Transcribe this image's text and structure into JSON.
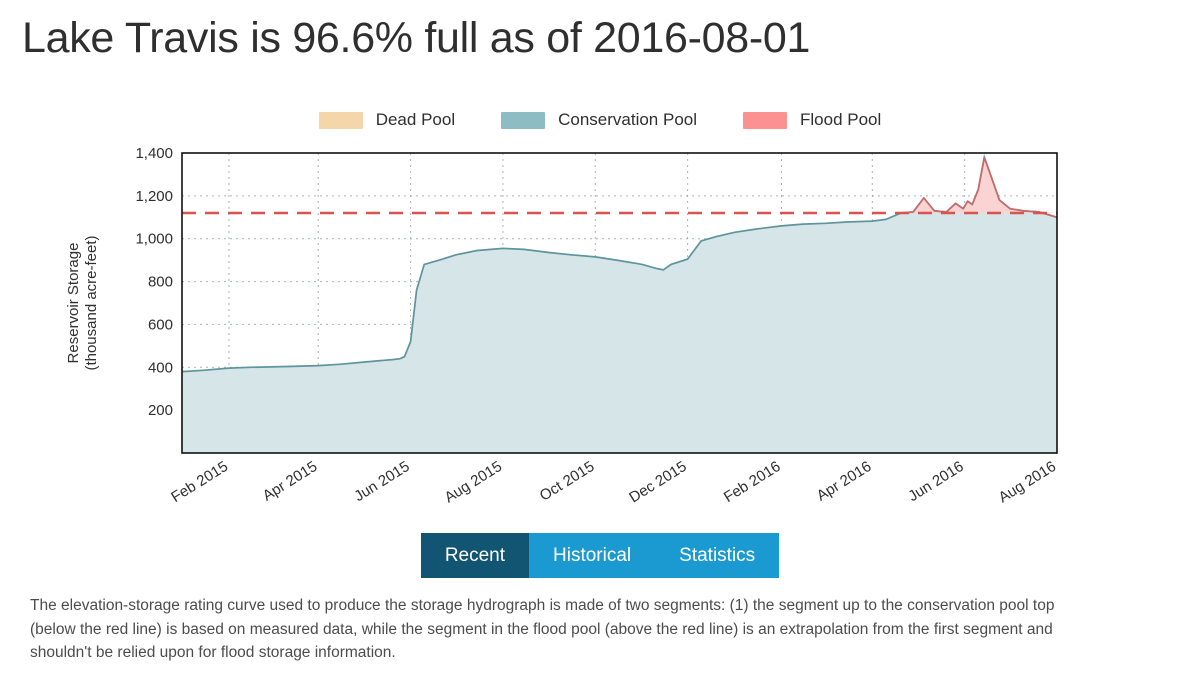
{
  "page": {
    "title": "Lake Travis is 96.6% full as of 2016-08-01",
    "lake_name": "Lake Travis",
    "percent_full": "96.6%",
    "as_of_date": "2016-08-01"
  },
  "legend": {
    "position": "top-center",
    "items": [
      {
        "label": "Dead Pool",
        "color": "#f5d5aa",
        "name": "dead-pool"
      },
      {
        "label": "Conservation Pool",
        "color": "#8dbcc5",
        "name": "conservation-pool"
      },
      {
        "label": "Flood Pool",
        "color": "#fb9191",
        "name": "flood-pool"
      }
    ]
  },
  "tabs": [
    {
      "label": "Recent",
      "active": true
    },
    {
      "label": "Historical",
      "active": false
    },
    {
      "label": "Statistics",
      "active": false
    }
  ],
  "footer": {
    "lines": [
      "The elevation-storage rating curve used to produce the storage hydrograph is made of two segments: (1) the segment up to the conservation pool top",
      "(below the red line) is based on measured data, while the segment in the flood pool (above the red line) is an extrapolation from the first segment and",
      "shouldn't be relied upon for flood storage information."
    ]
  },
  "colors": {
    "title_text": "#2f2f2f",
    "tab_active_bg": "#115573",
    "tab_inactive_bg": "#1b9ad1",
    "tab_text": "#ffffff",
    "conservation_fill": "#d5e5e8",
    "conservation_line": "#5e949c",
    "flood_fill": "#fbd3d3",
    "flood_line": "#c96a6a",
    "dead_fill": "#f5dcba",
    "conservation_top_line": "#d9534f",
    "grid": "#9aa6a8",
    "axis": "#111111",
    "plot_bg": "#ffffff"
  },
  "chart_data": {
    "type": "area",
    "title": "",
    "xlabel": "",
    "ylabel": "Reservoir Storage\n(thousand acre-feet)",
    "ylabel_line1": "Reservoir Storage",
    "ylabel_line2": "(thousand acre-feet)",
    "yunit": "thousand acre-feet",
    "grid": true,
    "ylim": [
      0,
      1400
    ],
    "yticks": [
      200,
      400,
      600,
      800,
      1000,
      1200,
      1400
    ],
    "ytick_labels": [
      "200",
      "400",
      "600",
      "800",
      "1,000",
      "1,200",
      "1,400"
    ],
    "xlim": [
      "2015-01-01",
      "2016-08-01"
    ],
    "xticks": [
      "2015-02-01",
      "2015-04-01",
      "2015-06-01",
      "2015-08-01",
      "2015-10-01",
      "2015-12-01",
      "2016-02-01",
      "2016-04-01",
      "2016-06-01",
      "2016-08-01"
    ],
    "xtick_labels": [
      "Feb 2015",
      "Apr 2015",
      "Jun 2015",
      "Aug 2015",
      "Oct 2015",
      "Dec 2015",
      "Feb 2016",
      "Apr 2016",
      "Jun 2016",
      "Aug 2016"
    ],
    "xtick_rotation": -32,
    "annotations": [
      {
        "name": "conservation-pool-top",
        "type": "hline",
        "y": 1120,
        "style": "dashed",
        "color": "#d9534f",
        "label": ""
      }
    ],
    "bands": [
      {
        "name": "dead-pool",
        "y_from": 0,
        "y_to": 28,
        "color": "#f5dcba"
      },
      {
        "name": "conservation-pool",
        "y_from": 28,
        "y_to": 1120,
        "color": "#d5e5e8"
      },
      {
        "name": "flood-pool",
        "y_from": 1120,
        "y_to": 1400,
        "color": "#fbd3d3"
      }
    ],
    "series": [
      {
        "name": "Reservoir Storage",
        "line_color": "#5e949c",
        "fill_below_color": "#d5e5e8",
        "fill_above_color": "#fbd3d3",
        "x": [
          "2015-01-01",
          "2015-01-15",
          "2015-02-01",
          "2015-02-15",
          "2015-03-01",
          "2015-03-15",
          "2015-04-01",
          "2015-04-15",
          "2015-05-01",
          "2015-05-10",
          "2015-05-20",
          "2015-05-25",
          "2015-05-28",
          "2015-06-01",
          "2015-06-05",
          "2015-06-10",
          "2015-06-20",
          "2015-07-01",
          "2015-07-15",
          "2015-08-01",
          "2015-08-15",
          "2015-09-01",
          "2015-09-15",
          "2015-10-01",
          "2015-10-15",
          "2015-11-01",
          "2015-11-10",
          "2015-11-15",
          "2015-11-20",
          "2015-12-01",
          "2015-12-10",
          "2015-12-20",
          "2016-01-01",
          "2016-01-15",
          "2016-02-01",
          "2016-02-15",
          "2016-03-01",
          "2016-03-15",
          "2016-04-01",
          "2016-04-10",
          "2016-04-20",
          "2016-04-28",
          "2016-05-05",
          "2016-05-12",
          "2016-05-20",
          "2016-05-26",
          "2016-05-31",
          "2016-06-03",
          "2016-06-06",
          "2016-06-10",
          "2016-06-14",
          "2016-06-18",
          "2016-06-24",
          "2016-07-01",
          "2016-07-10",
          "2016-07-20",
          "2016-08-01"
        ],
        "y": [
          380,
          386,
          396,
          400,
          402,
          404,
          408,
          414,
          424,
          430,
          436,
          440,
          450,
          520,
          760,
          880,
          900,
          925,
          945,
          955,
          950,
          935,
          925,
          915,
          900,
          880,
          862,
          855,
          880,
          905,
          990,
          1010,
          1030,
          1045,
          1060,
          1068,
          1072,
          1078,
          1082,
          1090,
          1120,
          1125,
          1190,
          1130,
          1125,
          1165,
          1140,
          1175,
          1160,
          1230,
          1380,
          1300,
          1180,
          1140,
          1130,
          1125,
          1100
        ]
      }
    ],
    "notable_values": {
      "start_storage": 380,
      "end_storage": 1100,
      "max_storage": 1380,
      "max_storage_date": "2016-06-14",
      "min_storage": 380,
      "min_storage_date": "2015-01-01",
      "conservation_pool_top": 1120
    }
  }
}
